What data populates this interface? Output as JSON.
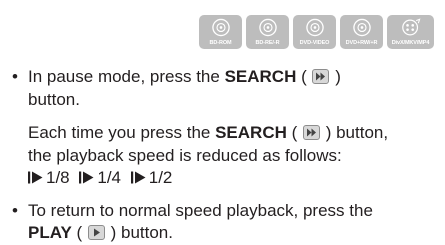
{
  "disc_formats": [
    {
      "label": "BD-ROM",
      "icon": "disc-icon"
    },
    {
      "label": "BD-RE/-R",
      "icon": "disc-icon"
    },
    {
      "label": "DVD-VIDEO",
      "icon": "disc-icon"
    },
    {
      "label": "DVD+RW/+R",
      "icon": "disc-icon"
    },
    {
      "label": "DivX/MKV/MP4",
      "icon": "video-disc-icon"
    }
  ],
  "colors": {
    "badge_background": "#bdbdbd",
    "text": "#231f20",
    "button_icon_fill": "#d8d8d8"
  },
  "bullet_symbol": "•",
  "instructions": {
    "bullet1": {
      "pre": "In pause mode, press the ",
      "keyword": "SEARCH",
      "open_paren": " ( ",
      "icon": "search-forward-button-icon",
      "close_paren": " )",
      "post": "button."
    },
    "para1": {
      "pre": "Each time you press the ",
      "keyword": "SEARCH",
      "open_paren": " ( ",
      "icon": "search-forward-button-icon",
      "close_paren": " ) button,",
      "post": "the playback speed is reduced as follows:"
    },
    "speeds": [
      "1/8",
      "1/4",
      "1/2"
    ],
    "bullet2": {
      "pre": "To return to normal speed playback, press the",
      "keyword": "PLAY",
      "open_paren": " ( ",
      "icon": "play-button-icon",
      "post": " ) button."
    }
  }
}
